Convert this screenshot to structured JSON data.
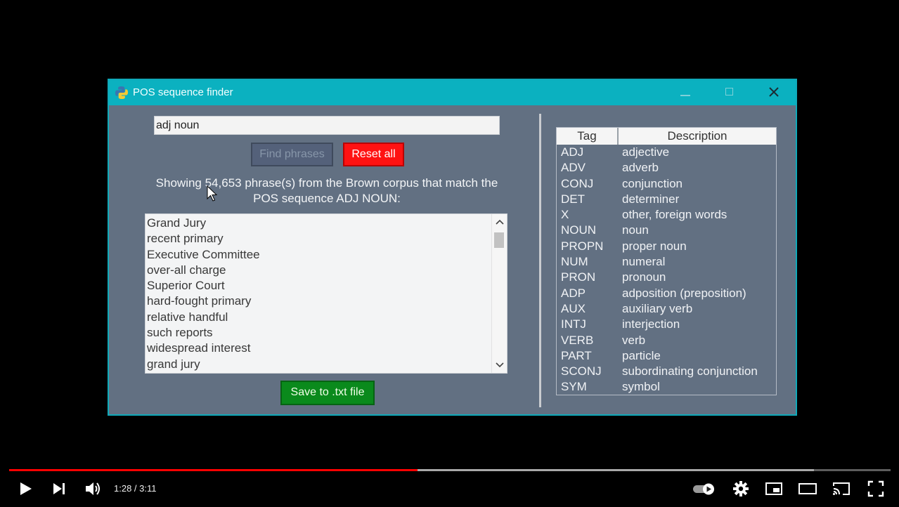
{
  "window": {
    "title": "POS sequence finder"
  },
  "search": {
    "value": "adj noun"
  },
  "buttons": {
    "find": "Find phrases",
    "reset": "Reset all",
    "save": "Save to .txt file"
  },
  "status": {
    "line1": "Showing 54,653 phrase(s) from the Brown corpus that match the",
    "line2": "POS sequence ADJ NOUN:"
  },
  "phrases": [
    "Grand Jury",
    "recent primary",
    "Executive Committee",
    "over-all charge",
    "Superior Court",
    "hard-fought primary",
    "relative handful",
    "such reports",
    "widespread interest",
    "grand jury"
  ],
  "tag_table": {
    "headers": {
      "tag": "Tag",
      "description": "Description"
    },
    "rows": [
      {
        "tag": "ADJ",
        "desc": "adjective"
      },
      {
        "tag": "ADV",
        "desc": "adverb"
      },
      {
        "tag": "CONJ",
        "desc": "conjunction"
      },
      {
        "tag": "DET",
        "desc": "determiner"
      },
      {
        "tag": "X",
        "desc": "other, foreign words"
      },
      {
        "tag": "NOUN",
        "desc": "noun"
      },
      {
        "tag": "PROPN",
        "desc": "proper noun"
      },
      {
        "tag": "NUM",
        "desc": "numeral"
      },
      {
        "tag": "PRON",
        "desc": "pronoun"
      },
      {
        "tag": "ADP",
        "desc": "adposition (preposition)"
      },
      {
        "tag": "AUX",
        "desc": "auxiliary verb"
      },
      {
        "tag": "INTJ",
        "desc": "interjection"
      },
      {
        "tag": "VERB",
        "desc": "verb"
      },
      {
        "tag": "PART",
        "desc": "particle"
      },
      {
        "tag": "SCONJ",
        "desc": "subordinating conjunction"
      },
      {
        "tag": "SYM",
        "desc": "symbol"
      }
    ]
  },
  "player": {
    "time": "1:28 / 3:11",
    "played_fraction": 0.463,
    "buffered_fraction": 0.913,
    "icons": [
      "play-icon",
      "next-icon",
      "volume-icon",
      "autoplay-toggle-icon",
      "settings-icon",
      "miniplayer-icon",
      "theater-icon",
      "cast-icon",
      "fullscreen-icon"
    ]
  },
  "colors": {
    "titlebar": "#0bb1c0",
    "window_bg": "#627082",
    "reset_button": "#ff1212",
    "save_button": "#0a8a1c",
    "progress_played": "#ff0000"
  }
}
